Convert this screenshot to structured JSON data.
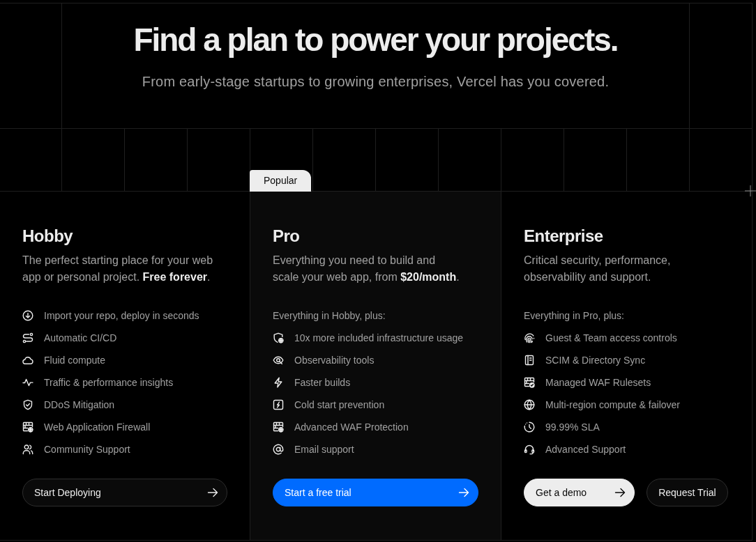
{
  "hero": {
    "title": "Find a plan to power your projects.",
    "subtitle": "From early-stage startups to growing enterprises, Vercel has you covered."
  },
  "plans": [
    {
      "name": "Hobby",
      "featured": false,
      "description": "The perfect starting place for your web app or personal project. **Free forever**.",
      "features": [
        "Import your repo, deploy in seconds",
        "Automatic CI/CD",
        "Fluid compute",
        "Traffic & performance insights",
        "DDoS Mitigation",
        "Web Application Firewall",
        "Community Support"
      ],
      "buttons": [
        {
          "label": "Start Deploying",
          "kind": "secondary",
          "arrow": true
        }
      ]
    },
    {
      "name": "Pro",
      "featured": true,
      "badge": "Popular",
      "description": "Everything you need to build and scale your web app, from **$20/month**.",
      "features_heading": "Everything in Hobby, plus:",
      "features": [
        "10x more included infrastructure usage",
        "Observability tools",
        "Faster builds",
        "Cold start prevention",
        "Advanced WAF Protection",
        "Email support"
      ],
      "buttons": [
        {
          "label": "Start a free trial",
          "kind": "primary",
          "arrow": true
        }
      ]
    },
    {
      "name": "Enterprise",
      "featured": false,
      "description": "Critical security, performance, observability and support.",
      "features_heading": "Everything in Pro, plus:",
      "features": [
        "Guest & Team access controls",
        "SCIM & Directory Sync",
        "Managed WAF Rulesets",
        "Multi-region compute & failover",
        "99.99% SLA",
        "Advanced Support"
      ],
      "buttons": [
        {
          "label": "Get a demo",
          "kind": "light",
          "arrow": true
        },
        {
          "label": "Request Trial",
          "kind": "secondary",
          "arrow": false
        }
      ]
    }
  ]
}
